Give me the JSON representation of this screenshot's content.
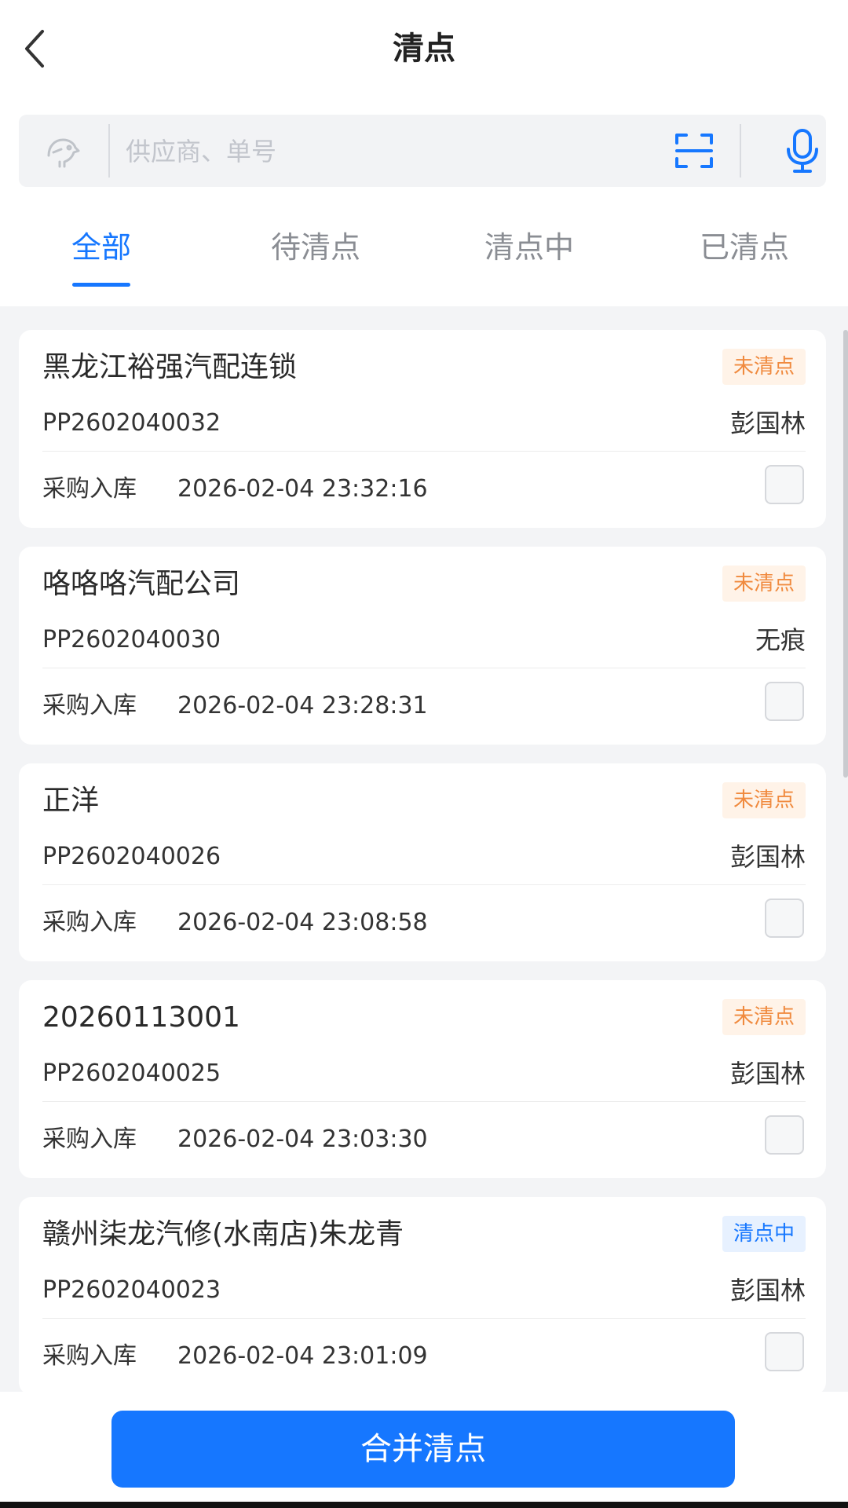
{
  "header": {
    "title": "清点",
    "back_icon": "chevron-left-icon"
  },
  "search": {
    "placeholder": "供应商、单号",
    "value": "",
    "left_icon": "brand-logo-icon",
    "scan_icon": "scan-icon",
    "mic_icon": "microphone-icon"
  },
  "tabs": [
    {
      "label": "全部",
      "active": true
    },
    {
      "label": "待清点",
      "active": false
    },
    {
      "label": "清点中",
      "active": false
    },
    {
      "label": "已清点",
      "active": false
    }
  ],
  "orders": [
    {
      "supplier": "黑龙江裕强汽配连锁",
      "status": "未清点",
      "status_kind": "pending",
      "order_no": "PP2602040032",
      "operator": "彭国林",
      "type": "采购入库",
      "time": "2026-02-04 23:32:16",
      "checked": false
    },
    {
      "supplier": "咯咯咯汽配公司",
      "status": "未清点",
      "status_kind": "pending",
      "order_no": "PP2602040030",
      "operator": "无痕",
      "type": "采购入库",
      "time": "2026-02-04 23:28:31",
      "checked": false
    },
    {
      "supplier": "正洋",
      "status": "未清点",
      "status_kind": "pending",
      "order_no": "PP2602040026",
      "operator": "彭国林",
      "type": "采购入库",
      "time": "2026-02-04 23:08:58",
      "checked": false
    },
    {
      "supplier": "20260113001",
      "status": "未清点",
      "status_kind": "pending",
      "order_no": "PP2602040025",
      "operator": "彭国林",
      "type": "采购入库",
      "time": "2026-02-04 23:03:30",
      "checked": false
    },
    {
      "supplier": "赣州柒龙汽修(水南店)朱龙青",
      "status": "清点中",
      "status_kind": "counting",
      "order_no": "PP2602040023",
      "operator": "彭国林",
      "type": "采购入库",
      "time": "2026-02-04 23:01:09",
      "checked": false
    }
  ],
  "footer": {
    "merge_label": "合并清点"
  },
  "colors": {
    "accent": "#1677ff",
    "pending_text": "#f08a3e",
    "pending_bg": "#fff3e8",
    "counting_bg": "#e7f1ff"
  }
}
